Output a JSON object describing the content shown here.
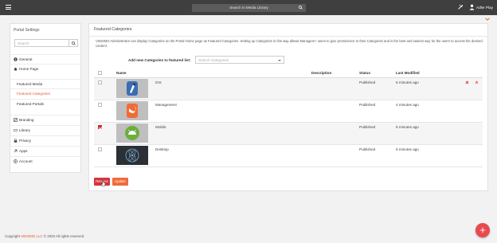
{
  "topbar": {
    "search_text": "Search in Media Library",
    "user_name": "Adler Play"
  },
  "sidebar": {
    "title": "Portal Settings",
    "search_placeholder": "Search",
    "items": [
      {
        "label": "General",
        "icon": "info-icon"
      },
      {
        "label": "Home Page",
        "icon": "home-icon"
      },
      {
        "label": "Featured Media",
        "icon": ""
      },
      {
        "label": "Featured Categories",
        "icon": "",
        "active": true
      },
      {
        "label": "Featured Portals",
        "icon": ""
      },
      {
        "label": "Branding",
        "icon": "branding-icon"
      },
      {
        "label": "Library",
        "icon": "library-icon"
      },
      {
        "label": "Privacy",
        "icon": "lock-icon"
      },
      {
        "label": "Apps",
        "icon": "apps-icon"
      },
      {
        "label": "Account",
        "icon": "account-icon"
      }
    ]
  },
  "main": {
    "title": "Featured Categories",
    "description": "VIDIZMO Administrator can display Categories on the Portal Home page as Featured Categories. Setting up Categories in this way allows Managers+ users to give prominence to their Categories and is the best and easiest way for the users to access the desired content.",
    "add_label": "Add new Categories to featured list:",
    "add_placeholder": "Search Categories",
    "columns": {
      "name": "Name",
      "description": "Description",
      "status": "Status",
      "modified": "Last Modified"
    },
    "rows": [
      {
        "name": "iOS",
        "status": "Published",
        "modified": "5 minutes ago",
        "checked": false,
        "thumb": "ios-thumb"
      },
      {
        "name": "Management",
        "status": "Published",
        "modified": "4 minutes ago",
        "checked": false,
        "thumb": "swift-thumb"
      },
      {
        "name": "Mobile",
        "status": "Published",
        "modified": "5 minutes ago",
        "checked": true,
        "thumb": "android-thumb"
      },
      {
        "name": "Desktop",
        "status": "Published",
        "modified": "5 minutes ago",
        "checked": false,
        "thumb": "atom-thumb"
      }
    ],
    "remove_label": "Remove",
    "update_label": "Update"
  },
  "footer": {
    "prefix": "Copyright",
    "brand": "VIDIZMO LLC",
    "suffix": "© 2020 All rights reserved"
  },
  "fab": {
    "label": "+"
  },
  "colors": {
    "accent": "#e8572d",
    "danger": "#d6343c",
    "update": "#f06b3d",
    "topbar": "#3f3f3f"
  }
}
